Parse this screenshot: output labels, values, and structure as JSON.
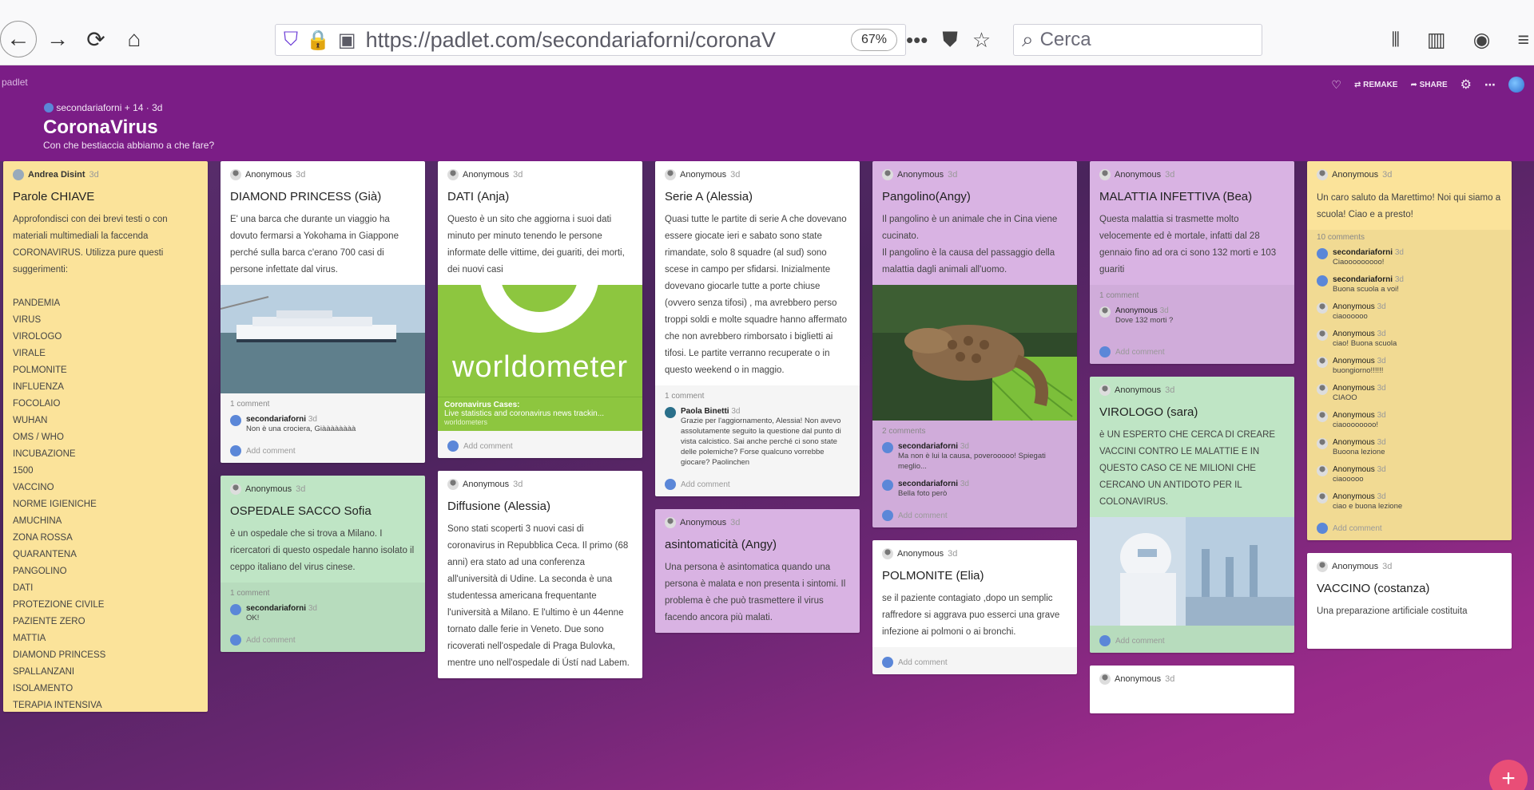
{
  "browser": {
    "url": "https://padlet.com/secondariaforni/coronaV",
    "zoom": "67%",
    "search_placeholder": "Cerca"
  },
  "header": {
    "app_label": "padlet",
    "author_line": "secondariaforni + 14 · 3d",
    "title": "CoronaVirus",
    "subtitle": "Con che bestiaccia abbiamo a che fare?",
    "remake_label": "REMAKE",
    "share_label": "SHARE"
  },
  "posts": {
    "parole": {
      "author": "Andrea Disint",
      "time": "3d",
      "title": "Parole CHIAVE",
      "body": "Approfondisci con dei brevi testi o con materiali multimediali la faccenda CORONAVIRUS. Utilizza pure questi suggerimenti:",
      "keywords": "PANDEMIA\nVIRUS\nVIROLOGO\nVIRALE\nPOLMONITE\nINFLUENZA\nFOCOLAIO\nWUHAN\nOMS / WHO\nINCUBAZIONE\n1500\nVACCINO\nNORME IGIENICHE\nAMUCHINA\nZONA ROSSA\nQUARANTENA\nPANGOLINO\nDATI\nPROTEZIONE CIVILE\nPAZIENTE ZERO\nMATTIA\nDIAMOND PRINCESS\nSPALLANZANI\nISOLAMENTO\nTERAPIA INTENSIVA\nOSPEDALE SACCO"
    },
    "diamond": {
      "author": "Anonymous",
      "time": "3d",
      "title": "DIAMOND PRINCESS (Già)",
      "body": "E' una barca che durante un viaggio ha dovuto fermarsi a Yokohama in Giappone perché sulla barca c'erano 700 casi di persone infettate dal virus.",
      "comment_count": "1 comment",
      "comment_author": "secondariaforni",
      "comment_time": "3d",
      "comment_text": "Non è una crociera, Giàààààààà",
      "add_comment": "Add comment"
    },
    "sacco": {
      "author": "Anonymous",
      "time": "3d",
      "title": "OSPEDALE SACCO Sofia",
      "body": "è un ospedale che si trova a Milano. I ricercatori di questo ospedale hanno isolato il ceppo italiano del virus cinese.",
      "comment_count": "1 comment",
      "comment_author": "secondariaforni",
      "comment_time": "3d",
      "comment_text": "OK!",
      "add_comment": "Add comment"
    },
    "dati": {
      "author": "Anonymous",
      "time": "3d",
      "title": "DATI (Anja)",
      "body": "Questo è un sito che aggiorna i suoi dati minuto per minuto tenendo le persone informate delle vittime, dei guariti, dei morti, dei nuovi casi",
      "link_title": "Coronavirus Cases:",
      "link_desc": "Live statistics and coronavirus news trackin...",
      "link_source": "worldometers",
      "logo_text": "worldometer",
      "add_comment": "Add comment"
    },
    "diffusione": {
      "author": "Anonymous",
      "time": "3d",
      "title": "Diffusione (Alessia)",
      "body": "Sono stati scoperti 3 nuovi casi di coronavirus in Repubblica Ceca. Il primo (68 anni) era stato ad una conferenza all'università di Udine. La seconda è una studentessa americana frequentante l'università a Milano. E l'ultimo è un 44enne tornato dalle ferie in Veneto. Due sono ricoverati nell'ospedale di Praga Bulovka, mentre uno nell'ospedale di Ústí nad Labem."
    },
    "seriea": {
      "author": "Anonymous",
      "time": "3d",
      "title": "Serie A (Alessia)",
      "body": "Quasi tutte le partite di serie A che dovevano essere giocate ieri e sabato sono state rimandate, solo 8 squadre (al sud) sono scese in campo per sfidarsi. Inizialmente dovevano giocarle tutte a porte chiuse (ovvero senza tifosi) , ma avrebbero perso troppi soldi e molte squadre hanno affermato che non avrebbero rimborsato i biglietti ai tifosi. Le partite verranno recuperate o in questo weekend o in maggio.",
      "comment_count": "1 comment",
      "comment_author": "Paola Binetti",
      "comment_time": "3d",
      "comment_text": "Grazie per l'aggiornamento, Alessia! Non avevo assolutamente seguito la questione dal punto di vista calcistico. Sai anche perché ci sono state delle polemiche? Forse qualcuno vorrebbe giocare? Paolinchen",
      "add_comment": "Add comment"
    },
    "asintomatici": {
      "author": "Anonymous",
      "time": "3d",
      "title": "asintomaticità (Angy)",
      "body": "Una persona è asintomatica quando una persona è malata e non presenta i sintomi. Il problema è che può trasmettere il virus facendo ancora più malati."
    },
    "pangolino": {
      "author": "Anonymous",
      "time": "3d",
      "title": "Pangolino(Angy)",
      "body": "Il pangolino è un animale che in Cina viene cucinato.\nIl pangolino è la causa del passaggio della malattia dagli animali all'uomo.",
      "comment_count": "2 comments",
      "comments": [
        {
          "author": "secondariaforni",
          "time": "3d",
          "text": "Ma non è lui la causa, poverooooo! Spiegati meglio..."
        },
        {
          "author": "secondariaforni",
          "time": "3d",
          "text": "Bella foto però"
        }
      ],
      "add_comment": "Add comment"
    },
    "polmonite": {
      "author": "Anonymous",
      "time": "3d",
      "title": "POLMONITE (Elia)",
      "body": "se il paziente contagiato ,dopo un semplic raffredore si aggrava puo esserci una grave infezione ai polmoni o ai bronchi.",
      "add_comment": "Add comment"
    },
    "malattia": {
      "author": "Anonymous",
      "time": "3d",
      "title": "MALATTIA INFETTIVA (Bea)",
      "body": "Questa malattia si trasmette molto velocemente ed è mortale, infatti dal 28 gennaio fino ad ora ci sono 132 morti e 103 guariti",
      "comment_count": "1 comment",
      "comment_author": "Anonymous",
      "comment_time": "3d",
      "comment_text": "Dove 132 morti ?",
      "add_comment": "Add comment"
    },
    "virologo": {
      "author": "Anonymous",
      "time": "3d",
      "title": "VIROLOGO (sara)",
      "body": "è UN ESPERTO CHE  CERCA DI CREARE VACCINI CONTRO LE MALATTIE E IN QUESTO CASO CE NE MILIONI CHE CERCANO UN ANTIDOTO PER IL COLONAVIRUS.",
      "add_comment": "Add comment"
    },
    "anon_bottom": {
      "author": "Anonymous",
      "time": "3d"
    },
    "marettimo": {
      "author": "Anonymous",
      "time": "3d",
      "body": "Un caro saluto da Marettimo! Noi qui siamo a scuola! Ciao e a presto!",
      "comment_count": "10 comments",
      "comments": [
        {
          "author": "secondariaforni",
          "time": "3d",
          "text": "Ciaooooooooo!"
        },
        {
          "author": "secondariaforni",
          "time": "3d",
          "text": "Buona scuola a voi!"
        },
        {
          "author": "Anonymous",
          "time": "3d",
          "text": "ciaoooooo"
        },
        {
          "author": "Anonymous",
          "time": "3d",
          "text": "ciao! Buona scuola"
        },
        {
          "author": "Anonymous",
          "time": "3d",
          "text": "buongiorno!!!!!!"
        },
        {
          "author": "Anonymous",
          "time": "3d",
          "text": "CIAOO"
        },
        {
          "author": "Anonymous",
          "time": "3d",
          "text": "ciaoooooooo!"
        },
        {
          "author": "Anonymous",
          "time": "3d",
          "text": "Buoona lezione"
        },
        {
          "author": "Anonymous",
          "time": "3d",
          "text": "ciaooooo"
        },
        {
          "author": "Anonymous",
          "time": "3d",
          "text": "ciao e buona lezione"
        }
      ],
      "add_comment": "Add comment"
    },
    "vaccino": {
      "author": "Anonymous",
      "time": "3d",
      "title": "VACCINO (costanza)",
      "body": "Una preparazione artificiale costituita"
    }
  }
}
